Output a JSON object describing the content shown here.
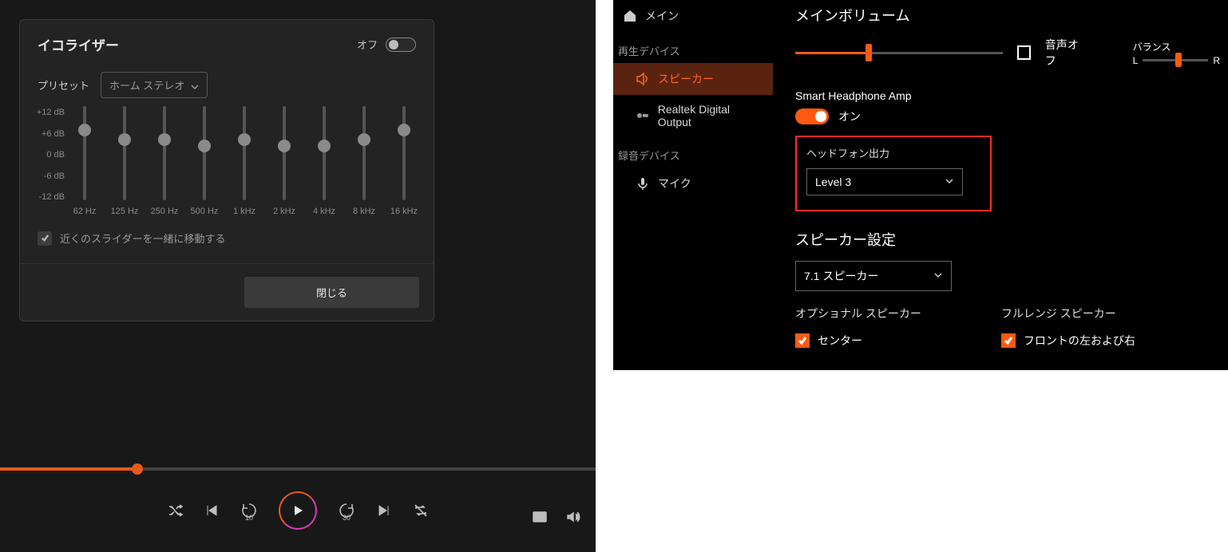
{
  "equalizer": {
    "title": "イコライザー",
    "off_label": "オフ",
    "preset_label": "プリセット",
    "preset_value": "ホーム ステレオ",
    "scale": [
      "+12 dB",
      "+6 dB",
      "0 dB",
      "-6 dB",
      "-12 dB"
    ],
    "bands": [
      {
        "freq": "62 Hz",
        "pos": 22
      },
      {
        "freq": "125 Hz",
        "pos": 34
      },
      {
        "freq": "250 Hz",
        "pos": 34
      },
      {
        "freq": "500 Hz",
        "pos": 42
      },
      {
        "freq": "1 kHz",
        "pos": 34
      },
      {
        "freq": "2 kHz",
        "pos": 42
      },
      {
        "freq": "4 kHz",
        "pos": 42
      },
      {
        "freq": "8 kHz",
        "pos": 34
      },
      {
        "freq": "16 kHz",
        "pos": 22
      }
    ],
    "move_neighbors": "近くのスライダーを一緒に移動する",
    "close": "閉じる"
  },
  "player": {
    "skip_back": "10",
    "skip_fwd": "30"
  },
  "realtek": {
    "nav": {
      "main": "メイン",
      "cat_play": "再生デバイス",
      "speaker": "スピーカー",
      "digital": "Realtek Digital Output",
      "cat_rec": "録音デバイス",
      "mic": "マイク"
    },
    "main_vol": "メインボリューム",
    "mute": "音声オフ",
    "balance_label": "バランス",
    "bal_l": "L",
    "bal_r": "R",
    "hp_amp": "Smart Headphone Amp",
    "hp_on": "オン",
    "hp_out": "ヘッドフォン出力",
    "hp_level": "Level 3",
    "spk_settings": "スピーカー設定",
    "spk_config": "7.1 スピーカー",
    "optional": "オプショナル スピーカー",
    "fullrange": "フルレンジ スピーカー",
    "opt_center": "センター",
    "fr_front": "フロントの左および右"
  }
}
